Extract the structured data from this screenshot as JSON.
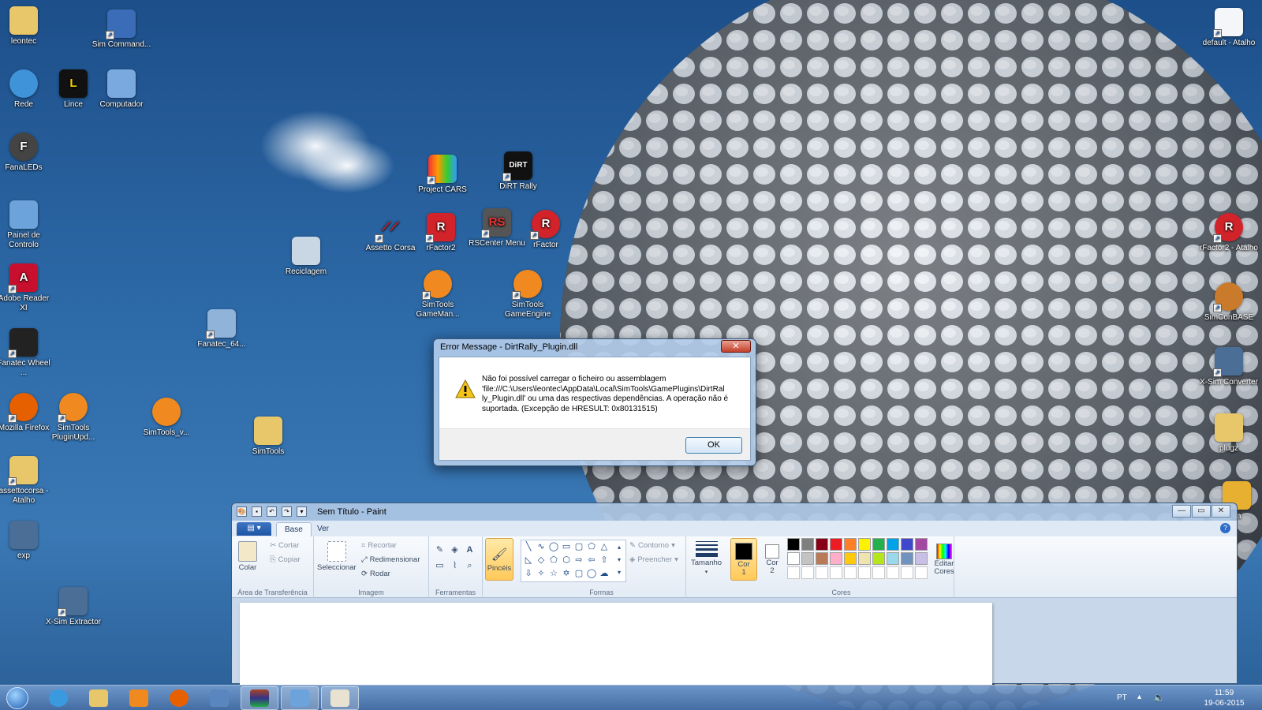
{
  "desktop": {
    "icons": [
      {
        "label": "leontec"
      },
      {
        "label": "Sim Command..."
      },
      {
        "label": "Rede"
      },
      {
        "label": "Lince"
      },
      {
        "label": "Computador"
      },
      {
        "label": "FanaLEDs"
      },
      {
        "label": "Painel de Controlo"
      },
      {
        "label": "Adobe Reader XI"
      },
      {
        "label": "Fanatec Wheel ..."
      },
      {
        "label": "Mozilla Firefox"
      },
      {
        "label": "SimTools PluginUpd..."
      },
      {
        "label": "assettocorsa - Atalho"
      },
      {
        "label": "exp"
      },
      {
        "label": "X-Sim Extractor"
      },
      {
        "label": "Reciclagem"
      },
      {
        "label": "Fanatec_64..."
      },
      {
        "label": "SimTools_v..."
      },
      {
        "label": "SimTools"
      },
      {
        "label": "Project CARS"
      },
      {
        "label": "DiRT Rally"
      },
      {
        "label": "Assetto Corsa"
      },
      {
        "label": "rFactor2"
      },
      {
        "label": "RSCenter Menu"
      },
      {
        "label": "rFactor"
      },
      {
        "label": "SimTools GameMan..."
      },
      {
        "label": "SimTools GameEngine"
      },
      {
        "label": "default - Atalho"
      },
      {
        "label": "rFactor2 - Atalho"
      },
      {
        "label": "SimConBASE"
      },
      {
        "label": "X-Sim Converter"
      },
      {
        "label": "plugz"
      },
      {
        "label": "ua"
      }
    ],
    "dirt_logo": "DiRT"
  },
  "dialog": {
    "title": "Error Message - DirtRally_Plugin.dll",
    "close": "✕",
    "message_lines": [
      "Não foi possível carregar o ficheiro ou assemblagem",
      "'file:///C:\\Users\\leontec\\AppData\\Local\\SimTools\\GamePlugins\\DirtRal",
      "ly_Plugin.dll' ou uma das respectivas dependências. A operação não é",
      "suportada. (Excepção de HRESULT: 0x80131515)"
    ],
    "ok_label": "OK"
  },
  "paint": {
    "title": "Sem Título - Paint",
    "tabs": {
      "base": "Base",
      "ver": "Ver"
    },
    "clipboard": {
      "paste": "Colar",
      "cut": "Cortar",
      "copy": "Copiar",
      "label": "Área de Transferência"
    },
    "image": {
      "select": "Seleccionar",
      "crop": "Recortar",
      "resize": "Redimensionar",
      "rotate": "Rodar",
      "label": "Imagem"
    },
    "tools": {
      "label": "Ferramentas"
    },
    "brushes": {
      "label": "Pincéis"
    },
    "shapes": {
      "outline": "Contorno",
      "fill": "Preencher",
      "label": "Formas"
    },
    "size": {
      "label": "Tamanho"
    },
    "colors": {
      "color1": "Cor 1",
      "color2": "Cor 2",
      "edit": "Editar Cores",
      "label": "Cores",
      "palette_row1": [
        "#000000",
        "#7f7f7f",
        "#880015",
        "#ed1c24",
        "#ff7f27",
        "#fff200",
        "#22b14c",
        "#00a2e8",
        "#3f48cc",
        "#a349a4"
      ],
      "palette_row2": [
        "#ffffff",
        "#c3c3c3",
        "#b97a57",
        "#ffaec9",
        "#ffc90e",
        "#efe4b0",
        "#b5e61d",
        "#99d9ea",
        "#7092be",
        "#c8bfe7"
      ]
    }
  },
  "taskbar": {
    "lang": "PT",
    "time": "11:59",
    "date": "19-06-2015"
  }
}
